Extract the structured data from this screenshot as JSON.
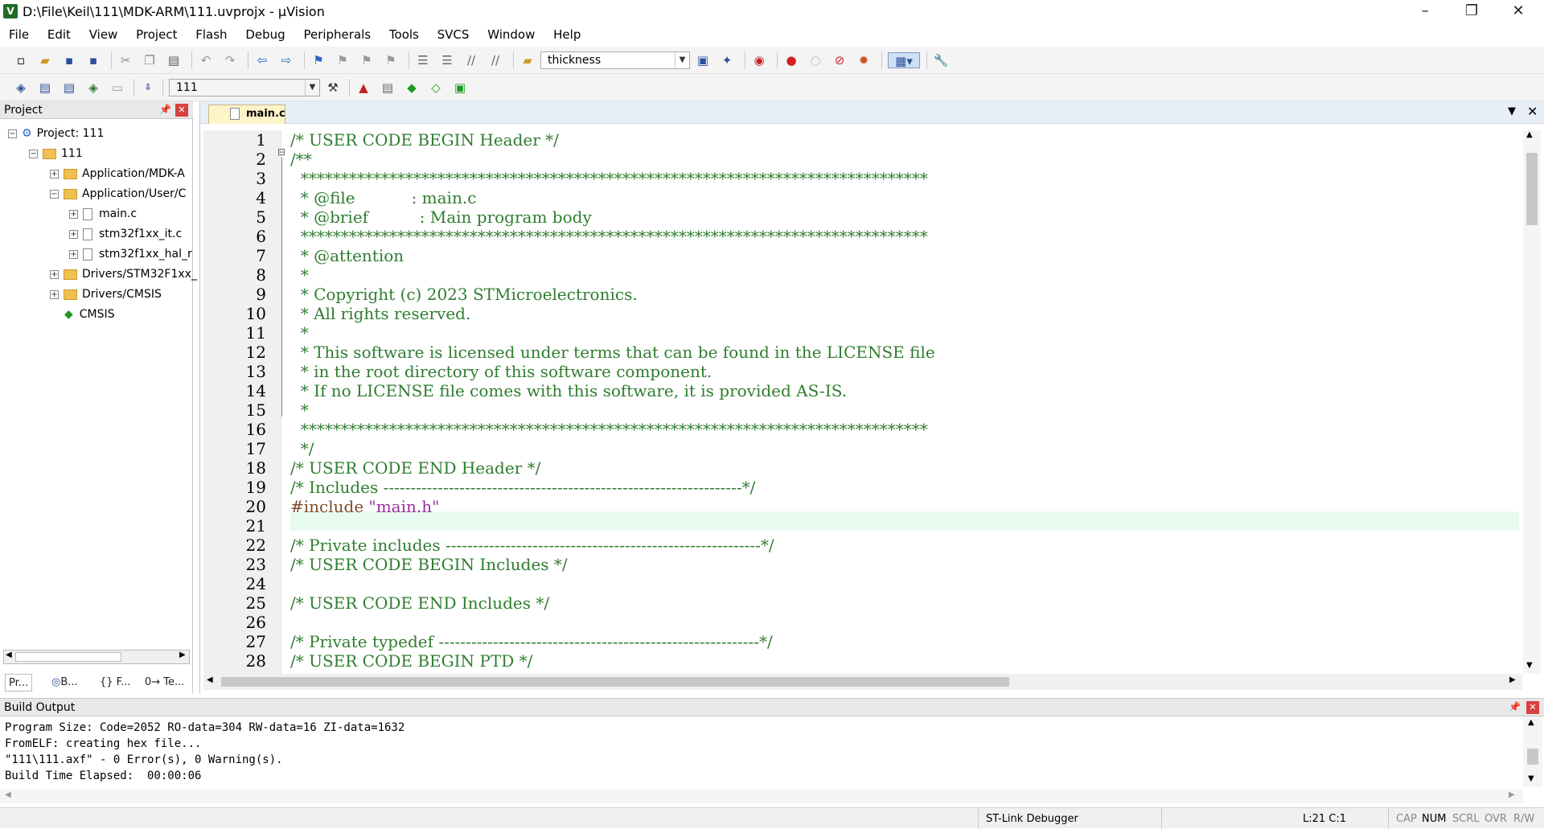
{
  "window": {
    "title": "D:\\File\\Keil\\111\\MDK-ARM\\111.uvprojx - µVision",
    "icon": "V",
    "minimize": "–",
    "restore": "❐",
    "close": "✕"
  },
  "menu": [
    "File",
    "Edit",
    "View",
    "Project",
    "Flash",
    "Debug",
    "Peripherals",
    "Tools",
    "SVCS",
    "Window",
    "Help"
  ],
  "toolbar1": {
    "find_combo_value": "thickness"
  },
  "toolbar2": {
    "target_combo_value": "111"
  },
  "project_panel": {
    "title": "Project",
    "tree": [
      {
        "label": "Project: 111"
      },
      {
        "label": "111"
      },
      {
        "label": "Application/MDK-A"
      },
      {
        "label": "Application/User/C"
      },
      {
        "label": "main.c"
      },
      {
        "label": "stm32f1xx_it.c"
      },
      {
        "label": "stm32f1xx_hal_r"
      },
      {
        "label": "Drivers/STM32F1xx_"
      },
      {
        "label": "Drivers/CMSIS"
      },
      {
        "label": "CMSIS"
      }
    ],
    "bottom_tabs": [
      "Pr...",
      "B...",
      "{} F...",
      "0→ Te..."
    ]
  },
  "editor": {
    "tab_label": "main.c",
    "lines": [
      {
        "n": "1",
        "text": "/* USER CODE BEGIN Header */",
        "kind": "cm"
      },
      {
        "n": "2",
        "text": "/**",
        "kind": "cm"
      },
      {
        "n": "3",
        "text": "  ******************************************************************************",
        "kind": "cm"
      },
      {
        "n": "4",
        "text": "  * @file           : main.c",
        "kind": "cm"
      },
      {
        "n": "5",
        "text": "  * @brief          : Main program body",
        "kind": "cm"
      },
      {
        "n": "6",
        "text": "  ******************************************************************************",
        "kind": "cm"
      },
      {
        "n": "7",
        "text": "  * @attention",
        "kind": "cm"
      },
      {
        "n": "8",
        "text": "  *",
        "kind": "cm"
      },
      {
        "n": "9",
        "text": "  * Copyright (c) 2023 STMicroelectronics.",
        "kind": "cm"
      },
      {
        "n": "10",
        "text": "  * All rights reserved.",
        "kind": "cm"
      },
      {
        "n": "11",
        "text": "  *",
        "kind": "cm"
      },
      {
        "n": "12",
        "text": "  * This software is licensed under terms that can be found in the LICENSE file",
        "kind": "cm"
      },
      {
        "n": "13",
        "text": "  * in the root directory of this software component.",
        "kind": "cm"
      },
      {
        "n": "14",
        "text": "  * If no LICENSE file comes with this software, it is provided AS-IS.",
        "kind": "cm"
      },
      {
        "n": "15",
        "text": "  *",
        "kind": "cm"
      },
      {
        "n": "16",
        "text": "  ******************************************************************************",
        "kind": "cm"
      },
      {
        "n": "17",
        "text": "  */",
        "kind": "cm"
      },
      {
        "n": "18",
        "text": "/* USER CODE END Header */",
        "kind": "cm"
      },
      {
        "n": "19",
        "text": "/* Includes ------------------------------------------------------------------*/",
        "kind": "cm"
      },
      {
        "n": "20",
        "text": "#include \"main.h\"",
        "kind": "pp"
      },
      {
        "n": "21",
        "text": "",
        "kind": "cm"
      },
      {
        "n": "22",
        "text": "/* Private includes ----------------------------------------------------------*/",
        "kind": "cm"
      },
      {
        "n": "23",
        "text": "/* USER CODE BEGIN Includes */",
        "kind": "cm"
      },
      {
        "n": "24",
        "text": "",
        "kind": "cm"
      },
      {
        "n": "25",
        "text": "/* USER CODE END Includes */",
        "kind": "cm"
      },
      {
        "n": "26",
        "text": "",
        "kind": "cm"
      },
      {
        "n": "27",
        "text": "/* Private typedef -----------------------------------------------------------*/",
        "kind": "cm"
      },
      {
        "n": "28",
        "text": "/* USER CODE BEGIN PTD */",
        "kind": "cm"
      }
    ]
  },
  "build_output": {
    "title": "Build Output",
    "lines": [
      "Program Size: Code=2052 RO-data=304 RW-data=16 ZI-data=1632",
      "FromELF: creating hex file...",
      "\"111\\111.axf\" - 0 Error(s), 0 Warning(s).",
      "Build Time Elapsed:  00:00:06"
    ]
  },
  "statusbar": {
    "debugger": "ST-Link Debugger",
    "position": "L:21 C:1",
    "cap": "CAP",
    "num": "NUM",
    "scrl": "SCRL",
    "ovr": "OVR",
    "rw": "R/W"
  },
  "colors": {
    "comment": "#2f7d2f",
    "preprocessor": "#7f4b2a",
    "string": "#9a2ca2",
    "current_line": "#e8fbf0"
  }
}
